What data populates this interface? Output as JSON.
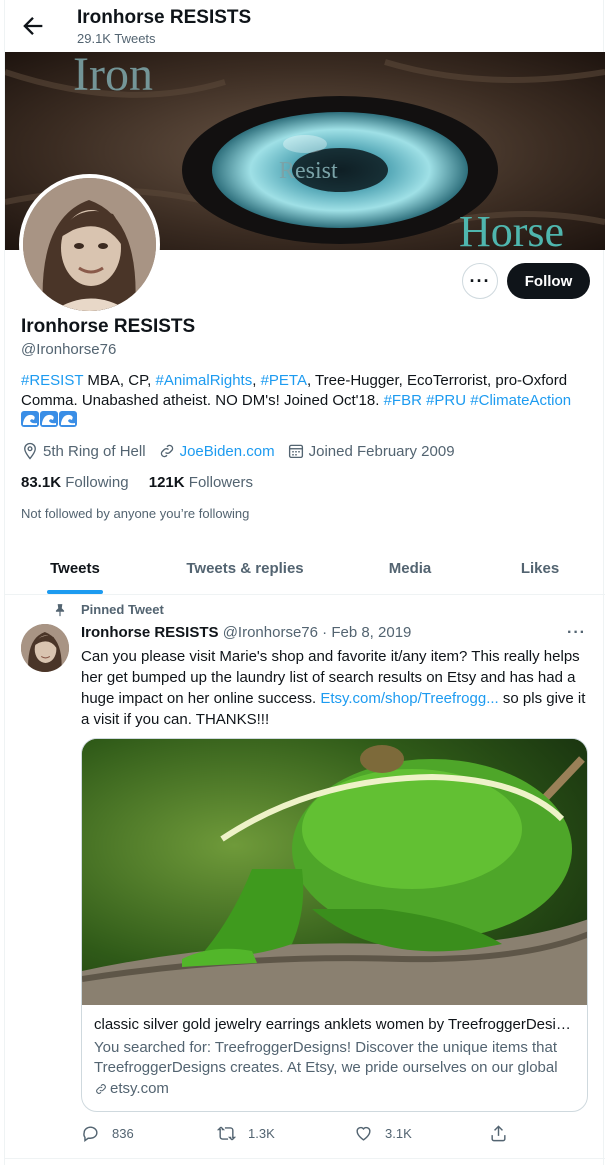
{
  "header": {
    "title": "Ironhorse RESISTS",
    "tweet_count": "29.1K Tweets"
  },
  "banner": {
    "word_top": "Iron",
    "word_center": "Resist",
    "word_bottom": "Horse"
  },
  "profile": {
    "name": "Ironhorse RESISTS",
    "handle": "@Ironhorse76",
    "follow_label": "Follow",
    "bio": {
      "tag_resist": "#RESIST",
      "text1": " MBA, CP, ",
      "tag_animal": "#AnimalRights",
      "text2": ", ",
      "tag_peta": "#PETA",
      "text3": ", Tree-Hugger, EcoTerrorist, pro-Oxford Comma.  Unabashed atheist.  NO DM's! Joined Oct'18. ",
      "tag_fbr": "#FBR",
      "tag_pru": "#PRU",
      "tag_climate": "#ClimateAction"
    },
    "location": "5th Ring of Hell",
    "website": "JoeBiden.com",
    "joined": "Joined February 2009",
    "following_count": "83.1K",
    "following_label": "Following",
    "followers_count": "121K",
    "followers_label": "Followers",
    "not_followed": "Not followed by anyone you’re following"
  },
  "tabs": [
    "Tweets",
    "Tweets & replies",
    "Media",
    "Likes"
  ],
  "tweet": {
    "pinned_label": "Pinned Tweet",
    "author": "Ironhorse RESISTS",
    "handle_date": "@Ironhorse76 · Feb 8, 2019",
    "text_before_link": "Can you please visit Marie's shop and favorite it/any item?  This really helps her get bumped up the laundry list of search results on Etsy and has had a huge impact on her online success.  ",
    "link": "Etsy.com/shop/Treefrogg...",
    "text_after_link": "  so pls give it a visit if you can.  THANKS!!!",
    "card": {
      "title": "classic silver gold jewelry earrings anklets women by TreefroggerDesig...",
      "description": "You searched for: TreefroggerDesigns! Discover the unique items that TreefroggerDesigns creates. At Etsy, we pride ourselves on our global ...",
      "domain": "etsy.com"
    },
    "replies": "836",
    "retweets": "1.3K",
    "likes": "3.1K"
  },
  "colors": {
    "accent": "#1d9bf0",
    "text": "#0f1419",
    "secondary": "#536471"
  }
}
